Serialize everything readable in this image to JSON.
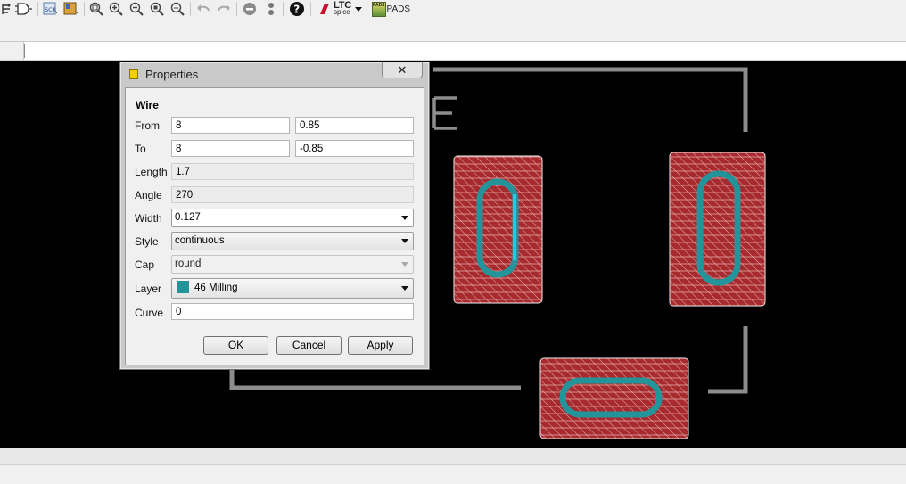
{
  "toolbar": {
    "items": [
      {
        "name": "netlist-icon"
      },
      {
        "name": "gate-icon"
      },
      {
        "name": "script-icon",
        "label": "SCR"
      },
      {
        "name": "ulp-icon"
      },
      {
        "name": "zoom-fit-icon"
      },
      {
        "name": "zoom-in-icon"
      },
      {
        "name": "zoom-out-icon"
      },
      {
        "name": "zoom-select-icon"
      },
      {
        "name": "zoom-previous-icon"
      },
      {
        "name": "undo-icon"
      },
      {
        "name": "redo-icon"
      },
      {
        "name": "stop-icon"
      },
      {
        "name": "go-icon"
      },
      {
        "name": "help-icon"
      }
    ],
    "ltspice_top": "LTC",
    "ltspice_bottom": "spice",
    "pads_badge": "PADS",
    "pads_label": "PADS"
  },
  "canvas": {
    "pad_fill": "#a62a2e",
    "milling_color": "#23959a",
    "outline_color": "#8c8c8c",
    "partial_text": "E"
  },
  "dialog": {
    "title": "Properties",
    "close": "✕",
    "section": "Wire",
    "from_label": "From",
    "from_x": "8",
    "from_y": "0.85",
    "to_label": "To",
    "to_x": "8",
    "to_y": "-0.85",
    "length_label": "Length",
    "length_value": "1.7",
    "angle_label": "Angle",
    "angle_value": "270",
    "width_label": "Width",
    "width_value": "0.127",
    "style_label": "Style",
    "style_value": "continuous",
    "cap_label": "Cap",
    "cap_value": "round",
    "layer_label": "Layer",
    "layer_value": "46 Milling",
    "layer_color": "#23959a",
    "curve_label": "Curve",
    "curve_value": "0",
    "ok": "OK",
    "cancel": "Cancel",
    "apply": "Apply"
  }
}
